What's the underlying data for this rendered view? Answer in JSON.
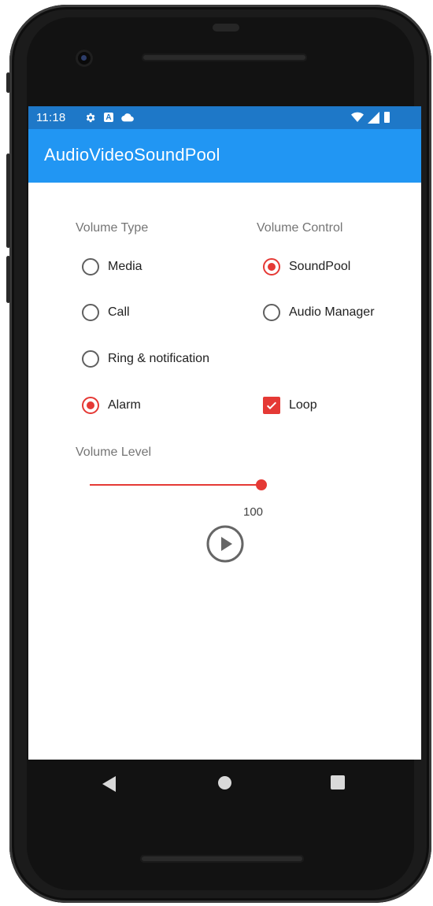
{
  "status_bar": {
    "time": "11:18",
    "icons": [
      "gear-icon",
      "a-icon",
      "cloud-icon",
      "wifi-icon",
      "signal-icon",
      "battery-icon"
    ]
  },
  "app_bar": {
    "title": "AudioVideoSoundPool"
  },
  "volume_type": {
    "label": "Volume Type",
    "options": [
      {
        "label": "Media",
        "selected": false
      },
      {
        "label": "Call",
        "selected": false
      },
      {
        "label": "Ring & notification",
        "selected": false
      },
      {
        "label": "Alarm",
        "selected": true
      }
    ]
  },
  "volume_control": {
    "label": "Volume Control",
    "options": [
      {
        "label": "SoundPool",
        "selected": true
      },
      {
        "label": "Audio Manager",
        "selected": false
      }
    ],
    "loop": {
      "label": "Loop",
      "checked": true
    }
  },
  "volume_level": {
    "label": "Volume Level",
    "value": "100",
    "fraction": 1.0
  },
  "colors": {
    "accent": "#e53935",
    "app_bar": "#2196f3",
    "status_bar": "#1e78c8"
  },
  "navigation": {
    "icons": [
      "back-icon",
      "home-icon",
      "recent-apps-icon"
    ]
  }
}
